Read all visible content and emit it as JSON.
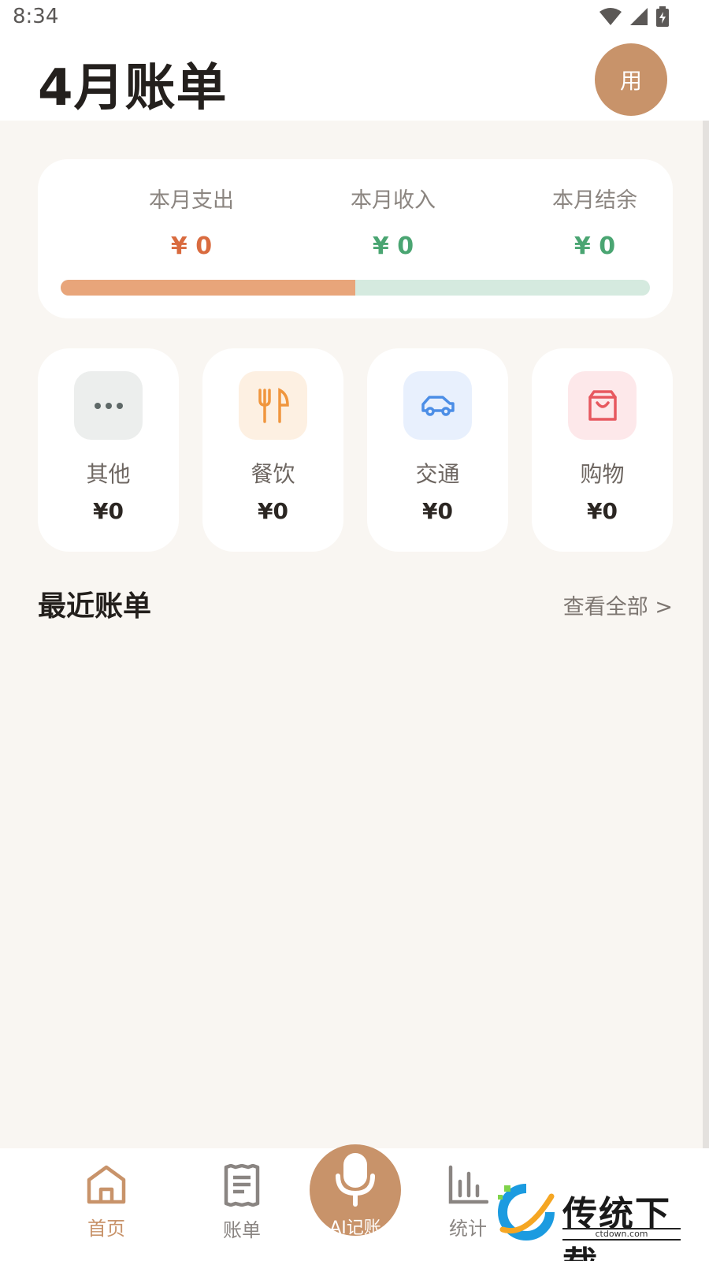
{
  "status_bar": {
    "time": "8:34"
  },
  "header": {
    "title": "4月账单",
    "avatar_text": "用"
  },
  "summary": {
    "expense": {
      "label": "本月支出",
      "value": "¥ 0",
      "color": "#d96b3f"
    },
    "income": {
      "label": "本月收入",
      "value": "¥ 0",
      "color": "#4aa572"
    },
    "balance": {
      "label": "本月结余",
      "value": "¥ 0",
      "color": "#4aa572"
    },
    "progress_fraction": 0.5
  },
  "categories": [
    {
      "name": "其他",
      "amount": "¥0",
      "icon": "more-dots-icon",
      "bg": "#eceeed",
      "fg": "#5e6867"
    },
    {
      "name": "餐饮",
      "amount": "¥0",
      "icon": "fork-knife-icon",
      "bg": "#fdf0e2",
      "fg": "#f0963e"
    },
    {
      "name": "交通",
      "amount": "¥0",
      "icon": "car-icon",
      "bg": "#e8f0fd",
      "fg": "#4c8ee6"
    },
    {
      "name": "购物",
      "amount": "¥0",
      "icon": "shopping-bag-icon",
      "bg": "#fde8ea",
      "fg": "#e7585f"
    }
  ],
  "recent": {
    "title": "最近账单",
    "view_all": "查看全部 >"
  },
  "tabbar": {
    "tabs": [
      {
        "label": "首页",
        "icon": "home-icon",
        "active": true
      },
      {
        "label": "账单",
        "icon": "receipt-icon",
        "active": false
      },
      {
        "label": "统计",
        "icon": "bar-chart-icon",
        "active": false
      }
    ],
    "mic_label": "AI记账",
    "active_color": "#c8936a",
    "inactive_color": "#8a8582"
  },
  "watermark": {
    "text": "传统下载",
    "sub": "ctdown.com"
  }
}
